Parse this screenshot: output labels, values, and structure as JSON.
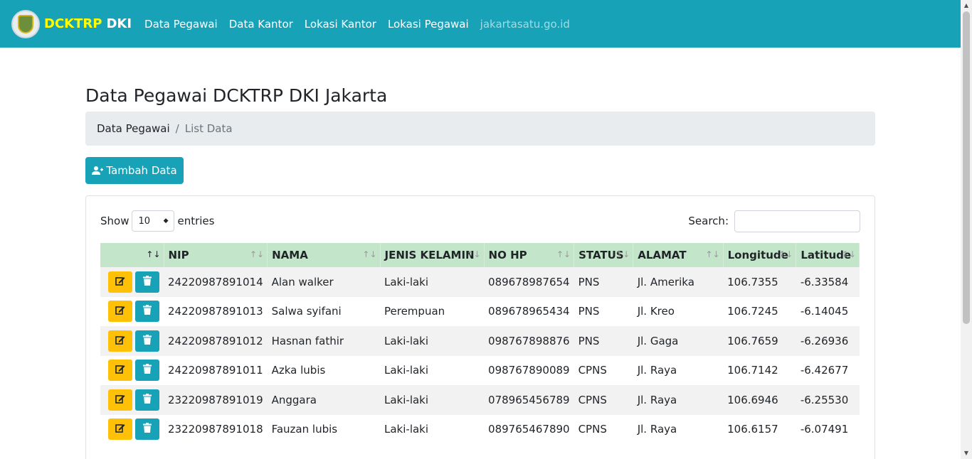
{
  "nav": {
    "brand_part1": "DCKTRP",
    "brand_part2": "DKI",
    "links": [
      "Data Pegawai",
      "Data Kantor",
      "Lokasi Kantor",
      "Lokasi Pegawai",
      "jakartasatu.go.id"
    ]
  },
  "page": {
    "title": "Data Pegawai DCKTRP DKI Jakarta",
    "breadcrumb": [
      "Data Pegawai",
      "List Data"
    ],
    "add_button": "Tambah Data"
  },
  "datatable": {
    "show_label": "Show",
    "entries_value": "10",
    "entries_label": "entries",
    "search_label": "Search:",
    "columns": [
      "",
      "NIP",
      "NAMA",
      "JENIS KELAMIN",
      "NO HP",
      "STATUS",
      "ALAMAT",
      "Longitude",
      "Latitude"
    ],
    "rows": [
      [
        "24220987891014",
        "Alan walker",
        "Laki-laki",
        "089678987654",
        "PNS",
        "Jl. Amerika",
        "106.7355",
        "-6.33584"
      ],
      [
        "24220987891013",
        "Salwa syifani",
        "Perempuan",
        "089678965434",
        "PNS",
        "Jl. Kreo",
        "106.7245",
        "-6.14045"
      ],
      [
        "24220987891012",
        "Hasnan fathir",
        "Laki-laki",
        "098767898876",
        "PNS",
        "Jl. Gaga",
        "106.7659",
        "-6.26936"
      ],
      [
        "24220987891011",
        "Azka lubis",
        "Laki-laki",
        "098767890089",
        "CPNS",
        "Jl. Raya",
        "106.7142",
        "-6.42677"
      ],
      [
        "23220987891019",
        "Anggara",
        "Laki-laki",
        "078965456789",
        "CPNS",
        "Jl. Raya",
        "106.6946",
        "-6.25530"
      ],
      [
        "23220987891018",
        "Fauzan lubis",
        "Laki-laki",
        "089765467890",
        "CPNS",
        "Jl. Raya",
        "106.6157",
        "-6.07491"
      ]
    ]
  },
  "colors": {
    "navbar": "#17a2b8",
    "brand_accent": "#ffff00",
    "header_row": "#c3e6cb",
    "edit_button": "#ffc107",
    "delete_button": "#17a2b8"
  }
}
